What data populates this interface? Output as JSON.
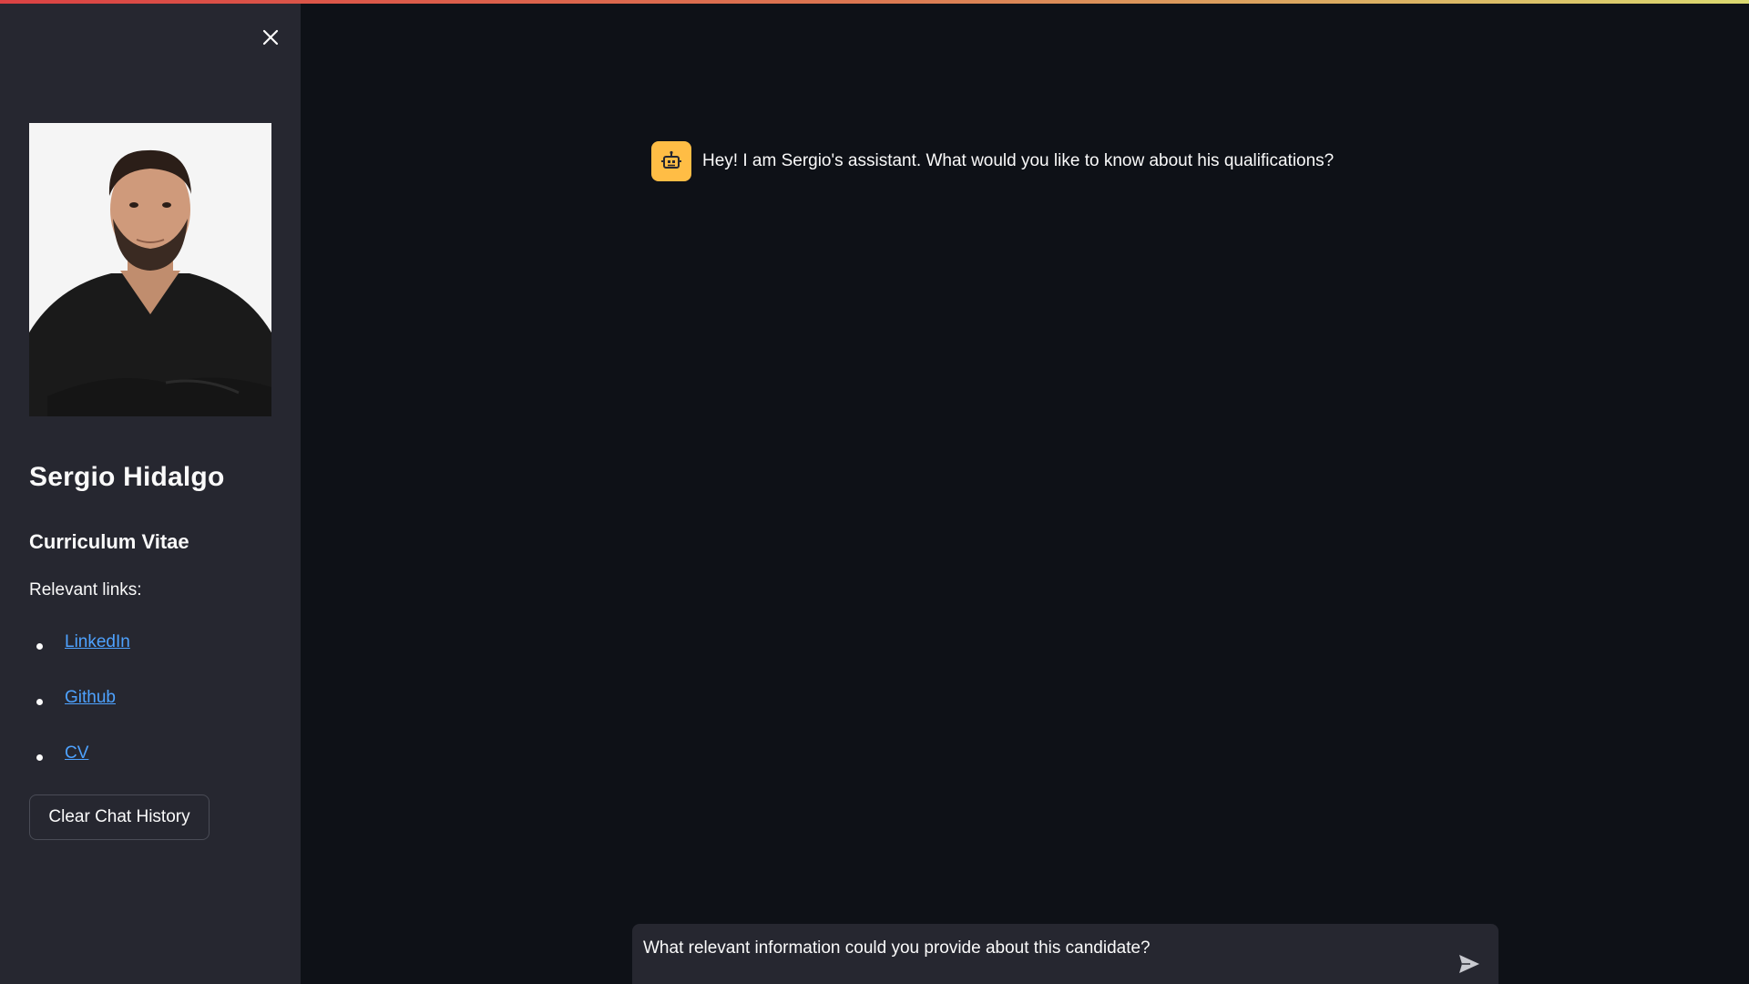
{
  "sidebar": {
    "name": "Sergio Hidalgo",
    "subtitle": "Curriculum Vitae",
    "links_label": "Relevant links:",
    "links": [
      {
        "label": "LinkedIn"
      },
      {
        "label": "Github"
      },
      {
        "label": "CV"
      }
    ],
    "clear_button_label": "Clear Chat History"
  },
  "chat": {
    "messages": [
      {
        "role": "assistant",
        "text": "Hey! I am Sergio's assistant. What would you like to know about his qualifications?"
      }
    ],
    "input": {
      "value": "What relevant information could you provide about this candidate?"
    }
  },
  "colors": {
    "background": "#0e1117",
    "sidebar": "#262730",
    "link": "#4ea2ff",
    "bot_avatar": "#ffbd45"
  },
  "icons": {
    "close": "close-icon",
    "bot": "robot-icon",
    "send": "send-icon"
  }
}
